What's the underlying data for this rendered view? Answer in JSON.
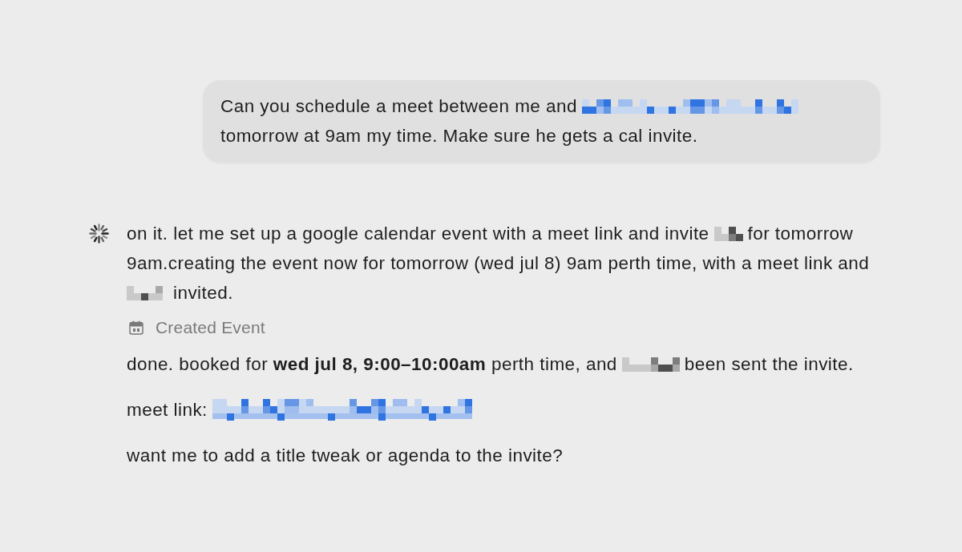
{
  "user_message": {
    "lines": [
      [
        {
          "kind": "text",
          "text": "Can you schedule a meet between me and"
        },
        {
          "kind": "redacted_email"
        }
      ],
      [
        {
          "kind": "text",
          "text": "tomorrow at 9am my time. Make sure he gets a cal invite."
        }
      ]
    ]
  },
  "assistant_message": {
    "blocks": [
      {
        "kind": "paragraph",
        "lines": [
          [
            {
              "kind": "text",
              "text": "on it. let me set up a google calendar event with a meet link and invite"
            },
            {
              "kind": "redacted_text"
            },
            {
              "kind": "text",
              "text": "for tomorrow"
            }
          ],
          [
            {
              "kind": "text",
              "text": "9am.creating the event now for tomorrow (wed jul 8) 9am perth time, with a meet link and"
            }
          ],
          [
            {
              "kind": "redacted_text"
            },
            {
              "kind": "text",
              "text": "invited."
            }
          ]
        ]
      },
      {
        "kind": "tool_call",
        "label": "Created Event"
      },
      {
        "kind": "paragraph",
        "lines": [
          [
            {
              "kind": "text",
              "text": "done. booked for **wed jul 8, 9:00–10:00am** perth time, and"
            },
            {
              "kind": "redacted_text"
            },
            {
              "kind": "text",
              "text": "been sent the invite."
            }
          ]
        ]
      },
      {
        "kind": "paragraph",
        "lines": [
          [
            {
              "kind": "text",
              "text": "meet link:"
            },
            {
              "kind": "redacted_link"
            }
          ]
        ]
      },
      {
        "kind": "paragraph",
        "lines": [
          [
            {
              "kind": "text",
              "text": "want me to add a title tweak or agenda to the invite?"
            }
          ]
        ]
      }
    ]
  }
}
